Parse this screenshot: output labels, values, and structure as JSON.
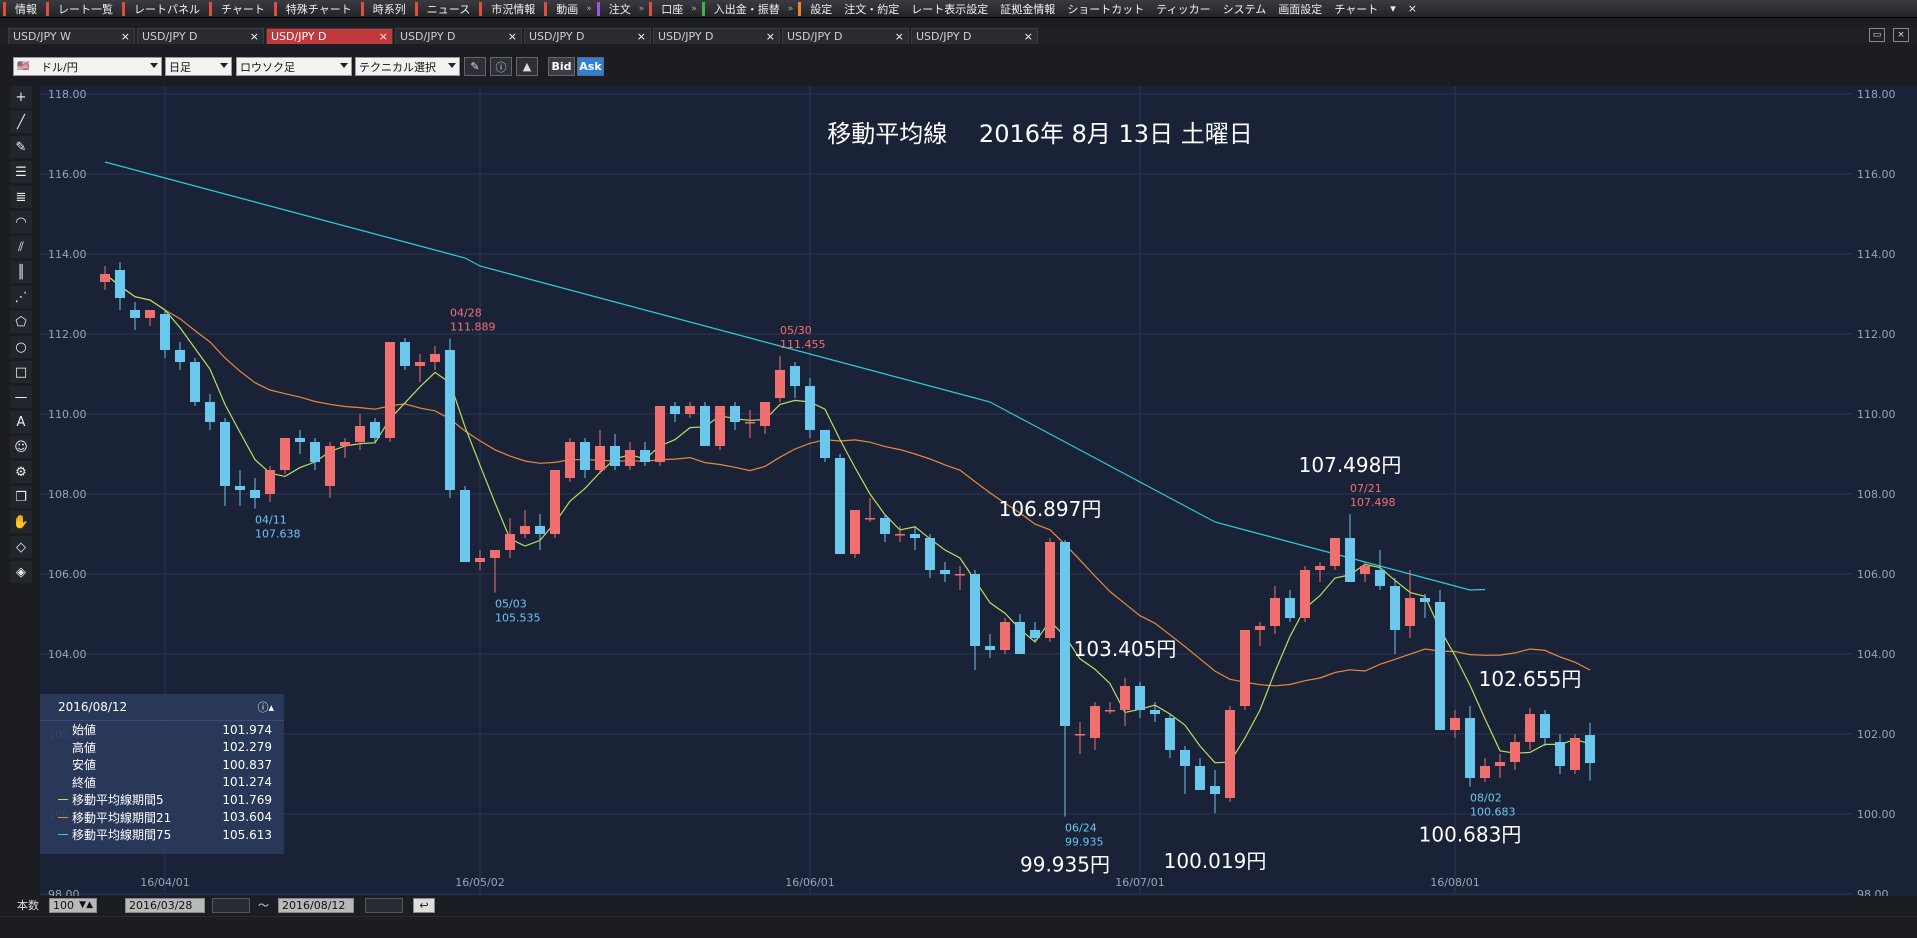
{
  "menu": {
    "items": [
      {
        "label": "情報",
        "color": "#e44c3c"
      },
      {
        "label": "レート一覧",
        "color": "#e44c3c"
      },
      {
        "label": "レートパネル",
        "color": "#e44c3c"
      },
      {
        "label": "チャート",
        "color": "#e44c3c"
      },
      {
        "label": "特殊チャート",
        "color": "#e44c3c"
      },
      {
        "label": "時系列",
        "color": "#e44c3c"
      },
      {
        "label": "ニュース",
        "color": "#e44c3c"
      },
      {
        "label": "市況情報",
        "color": "#e44c3c"
      },
      {
        "label": "動画",
        "color": "#e44c3c"
      },
      {
        "label": "注文",
        "color": "#9b59d6"
      },
      {
        "label": "口座",
        "color": "#e44c3c"
      },
      {
        "label": "入出金・振替",
        "color": "#3cb84a"
      },
      {
        "label": "設定",
        "color": "#e88a2a"
      },
      {
        "label": "注文・約定",
        "color": ""
      },
      {
        "label": "レート表示設定",
        "color": ""
      },
      {
        "label": "証拠金情報",
        "color": ""
      },
      {
        "label": "ショートカット",
        "color": ""
      },
      {
        "label": "ティッカー",
        "color": ""
      },
      {
        "label": "システム",
        "color": ""
      },
      {
        "label": "画面設定",
        "color": ""
      },
      {
        "label": "チャート",
        "color": ""
      }
    ],
    "more": "▾",
    "close": "×"
  },
  "tabs": [
    {
      "label": "USD/JPY W",
      "active": false
    },
    {
      "label": "USD/JPY D",
      "active": false
    },
    {
      "label": "USD/JPY D",
      "active": true
    },
    {
      "label": "USD/JPY D",
      "active": false
    },
    {
      "label": "USD/JPY D",
      "active": false
    },
    {
      "label": "USD/JPY D",
      "active": false
    },
    {
      "label": "USD/JPY D",
      "active": false
    },
    {
      "label": "USD/JPY D",
      "active": false
    }
  ],
  "toolbar": {
    "pair": "ドル/円",
    "period": "日足",
    "chart_type": "ロウソク足",
    "technical": "テクニカル選択",
    "bid": "Bid",
    "ask": "Ask"
  },
  "chart_data": {
    "type": "candlestick",
    "title": "移動平均線　 2016年 8月 13日 土曜日",
    "ylim": [
      98,
      118
    ],
    "y_ticks": [
      "118.00",
      "116.00",
      "114.00",
      "112.00",
      "110.00",
      "108.00",
      "106.00",
      "104.00",
      "102.00",
      "100.00",
      "98.00"
    ],
    "x_ticks": [
      {
        "label": "16/04/01",
        "date": "2016-04-01"
      },
      {
        "label": "16/05/02",
        "date": "2016-05-02"
      },
      {
        "label": "16/06/01",
        "date": "2016-06-01"
      },
      {
        "label": "16/07/01",
        "date": "2016-07-01"
      },
      {
        "label": "16/08/01",
        "date": "2016-08-01"
      }
    ],
    "colors": {
      "up": "#f07070",
      "down": "#6bc7ec",
      "ma5": "#b8e05a",
      "ma21": "#e58a3c",
      "ma75": "#2ec9d6",
      "grid": "#2b3650",
      "background": "#1a2238",
      "label_red": "#f07070",
      "label_blue": "#6bc7ec",
      "text": "#ffffff"
    },
    "candles": [
      {
        "d": "2016-03-28",
        "o": 113.3,
        "h": 113.7,
        "l": 113.1,
        "c": 113.5
      },
      {
        "d": "2016-03-29",
        "o": 113.6,
        "h": 113.8,
        "l": 112.6,
        "c": 112.9
      },
      {
        "d": "2016-03-30",
        "o": 112.6,
        "h": 112.8,
        "l": 112.1,
        "c": 112.4
      },
      {
        "d": "2016-03-31",
        "o": 112.4,
        "h": 112.6,
        "l": 112.2,
        "c": 112.6
      },
      {
        "d": "2016-04-01",
        "o": 112.5,
        "h": 112.6,
        "l": 111.4,
        "c": 111.6
      },
      {
        "d": "2016-04-04",
        "o": 111.6,
        "h": 111.8,
        "l": 111.1,
        "c": 111.3
      },
      {
        "d": "2016-04-05",
        "o": 111.3,
        "h": 111.4,
        "l": 110.2,
        "c": 110.3
      },
      {
        "d": "2016-04-06",
        "o": 110.3,
        "h": 110.5,
        "l": 109.6,
        "c": 109.8
      },
      {
        "d": "2016-04-07",
        "o": 109.8,
        "h": 109.9,
        "l": 107.7,
        "c": 108.2
      },
      {
        "d": "2016-04-08",
        "o": 108.2,
        "h": 108.6,
        "l": 107.7,
        "c": 108.1
      },
      {
        "d": "2016-04-11",
        "o": 108.1,
        "h": 108.4,
        "l": 107.638,
        "c": 107.9
      },
      {
        "d": "2016-04-12",
        "o": 108.0,
        "h": 108.7,
        "l": 107.8,
        "c": 108.6
      },
      {
        "d": "2016-04-13",
        "o": 108.6,
        "h": 109.4,
        "l": 108.5,
        "c": 109.4
      },
      {
        "d": "2016-04-14",
        "o": 109.4,
        "h": 109.6,
        "l": 109.0,
        "c": 109.3
      },
      {
        "d": "2016-04-15",
        "o": 109.3,
        "h": 109.4,
        "l": 108.6,
        "c": 108.8
      },
      {
        "d": "2016-04-18",
        "o": 108.2,
        "h": 109.3,
        "l": 107.9,
        "c": 109.2
      },
      {
        "d": "2016-04-19",
        "o": 109.2,
        "h": 109.4,
        "l": 108.9,
        "c": 109.3
      },
      {
        "d": "2016-04-20",
        "o": 109.3,
        "h": 110.0,
        "l": 109.1,
        "c": 109.7
      },
      {
        "d": "2016-04-21",
        "o": 109.8,
        "h": 109.9,
        "l": 109.3,
        "c": 109.4
      },
      {
        "d": "2016-04-22",
        "o": 109.4,
        "h": 111.8,
        "l": 109.3,
        "c": 111.8
      },
      {
        "d": "2016-04-25",
        "o": 111.8,
        "h": 111.9,
        "l": 111.1,
        "c": 111.2
      },
      {
        "d": "2016-04-26",
        "o": 111.2,
        "h": 111.5,
        "l": 110.8,
        "c": 111.3
      },
      {
        "d": "2016-04-27",
        "o": 111.3,
        "h": 111.7,
        "l": 111.1,
        "c": 111.5
      },
      {
        "d": "2016-04-28",
        "o": 111.6,
        "h": 111.889,
        "l": 107.9,
        "c": 108.1
      },
      {
        "d": "2016-04-29",
        "o": 108.1,
        "h": 108.2,
        "l": 106.3,
        "c": 106.3
      },
      {
        "d": "2016-05-02",
        "o": 106.3,
        "h": 106.6,
        "l": 106.1,
        "c": 106.4
      },
      {
        "d": "2016-05-03",
        "o": 106.4,
        "h": 106.6,
        "l": 105.535,
        "c": 106.6
      },
      {
        "d": "2016-05-04",
        "o": 106.6,
        "h": 107.4,
        "l": 106.4,
        "c": 107.0
      },
      {
        "d": "2016-05-05",
        "o": 107.0,
        "h": 107.6,
        "l": 106.9,
        "c": 107.2
      },
      {
        "d": "2016-05-06",
        "o": 107.2,
        "h": 107.5,
        "l": 106.6,
        "c": 107.0
      },
      {
        "d": "2016-05-09",
        "o": 107.0,
        "h": 108.6,
        "l": 106.9,
        "c": 108.6
      },
      {
        "d": "2016-05-10",
        "o": 108.4,
        "h": 109.4,
        "l": 108.3,
        "c": 109.3
      },
      {
        "d": "2016-05-11",
        "o": 109.3,
        "h": 109.4,
        "l": 108.4,
        "c": 108.6
      },
      {
        "d": "2016-05-12",
        "o": 108.6,
        "h": 109.6,
        "l": 108.5,
        "c": 109.2
      },
      {
        "d": "2016-05-13",
        "o": 109.2,
        "h": 109.5,
        "l": 108.6,
        "c": 108.7
      },
      {
        "d": "2016-05-16",
        "o": 108.7,
        "h": 109.3,
        "l": 108.6,
        "c": 109.1
      },
      {
        "d": "2016-05-17",
        "o": 109.1,
        "h": 109.3,
        "l": 108.7,
        "c": 108.8
      },
      {
        "d": "2016-05-18",
        "o": 108.8,
        "h": 110.2,
        "l": 108.7,
        "c": 110.2
      },
      {
        "d": "2016-05-19",
        "o": 110.2,
        "h": 110.3,
        "l": 109.8,
        "c": 110.0
      },
      {
        "d": "2016-05-20",
        "o": 110.0,
        "h": 110.3,
        "l": 109.9,
        "c": 110.2
      },
      {
        "d": "2016-05-23",
        "o": 110.2,
        "h": 110.3,
        "l": 109.2,
        "c": 109.2
      },
      {
        "d": "2016-05-24",
        "o": 109.2,
        "h": 110.2,
        "l": 109.1,
        "c": 110.2
      },
      {
        "d": "2016-05-25",
        "o": 110.2,
        "h": 110.3,
        "l": 109.6,
        "c": 109.8
      },
      {
        "d": "2016-05-26",
        "o": 109.8,
        "h": 110.1,
        "l": 109.4,
        "c": 109.8
      },
      {
        "d": "2016-05-27",
        "o": 109.7,
        "h": 110.3,
        "l": 109.5,
        "c": 110.3
      },
      {
        "d": "2016-05-30",
        "o": 110.4,
        "h": 111.455,
        "l": 110.3,
        "c": 111.1
      },
      {
        "d": "2016-05-31",
        "o": 111.2,
        "h": 111.3,
        "l": 110.4,
        "c": 110.7
      },
      {
        "d": "2016-06-01",
        "o": 110.7,
        "h": 110.9,
        "l": 109.4,
        "c": 109.6
      },
      {
        "d": "2016-06-02",
        "o": 109.6,
        "h": 109.6,
        "l": 108.8,
        "c": 108.9
      },
      {
        "d": "2016-06-03",
        "o": 108.9,
        "h": 109.0,
        "l": 106.5,
        "c": 106.5
      },
      {
        "d": "2016-06-06",
        "o": 106.5,
        "h": 107.6,
        "l": 106.4,
        "c": 107.6
      },
      {
        "d": "2016-06-07",
        "o": 107.4,
        "h": 107.9,
        "l": 107.3,
        "c": 107.4
      },
      {
        "d": "2016-06-08",
        "o": 107.4,
        "h": 107.5,
        "l": 106.8,
        "c": 107.0
      },
      {
        "d": "2016-06-09",
        "o": 107.0,
        "h": 107.2,
        "l": 106.8,
        "c": 107.0
      },
      {
        "d": "2016-06-10",
        "o": 107.0,
        "h": 107.2,
        "l": 106.6,
        "c": 106.9
      },
      {
        "d": "2016-06-13",
        "o": 106.9,
        "h": 107.0,
        "l": 105.9,
        "c": 106.1
      },
      {
        "d": "2016-06-14",
        "o": 106.1,
        "h": 106.3,
        "l": 105.8,
        "c": 106.0
      },
      {
        "d": "2016-06-15",
        "o": 106.0,
        "h": 106.2,
        "l": 105.6,
        "c": 106.0
      },
      {
        "d": "2016-06-16",
        "o": 106.0,
        "h": 106.1,
        "l": 103.6,
        "c": 104.2
      },
      {
        "d": "2016-06-17",
        "o": 104.2,
        "h": 104.5,
        "l": 103.9,
        "c": 104.1
      },
      {
        "d": "2016-06-20",
        "o": 104.1,
        "h": 104.9,
        "l": 104.0,
        "c": 104.8
      },
      {
        "d": "2016-06-21",
        "o": 104.8,
        "h": 105.0,
        "l": 104.0,
        "c": 104.0
      },
      {
        "d": "2016-06-22",
        "o": 104.6,
        "h": 104.8,
        "l": 104.3,
        "c": 104.4
      },
      {
        "d": "2016-06-23",
        "o": 104.4,
        "h": 106.897,
        "l": 104.3,
        "c": 106.8
      },
      {
        "d": "2016-06-24",
        "o": 106.8,
        "h": 106.85,
        "l": 99.935,
        "c": 102.2
      },
      {
        "d": "2016-06-27",
        "o": 102.0,
        "h": 102.3,
        "l": 101.5,
        "c": 102.0
      },
      {
        "d": "2016-06-28",
        "o": 101.9,
        "h": 102.8,
        "l": 101.6,
        "c": 102.7
      },
      {
        "d": "2016-06-29",
        "o": 102.6,
        "h": 102.8,
        "l": 102.5,
        "c": 102.6
      },
      {
        "d": "2016-06-30",
        "o": 102.6,
        "h": 103.405,
        "l": 102.2,
        "c": 103.2
      },
      {
        "d": "2016-07-01",
        "o": 103.2,
        "h": 103.3,
        "l": 102.4,
        "c": 102.6
      },
      {
        "d": "2016-07-04",
        "o": 102.6,
        "h": 102.8,
        "l": 102.3,
        "c": 102.5
      },
      {
        "d": "2016-07-05",
        "o": 102.4,
        "h": 102.5,
        "l": 101.4,
        "c": 101.6
      },
      {
        "d": "2016-07-06",
        "o": 101.6,
        "h": 101.7,
        "l": 100.5,
        "c": 101.2
      },
      {
        "d": "2016-07-07",
        "o": 101.2,
        "h": 101.4,
        "l": 100.6,
        "c": 100.6
      },
      {
        "d": "2016-07-08",
        "o": 100.7,
        "h": 101.1,
        "l": 100.019,
        "c": 100.5
      },
      {
        "d": "2016-07-11",
        "o": 100.4,
        "h": 102.7,
        "l": 100.3,
        "c": 102.6
      },
      {
        "d": "2016-07-12",
        "o": 102.7,
        "h": 104.6,
        "l": 102.6,
        "c": 104.6
      },
      {
        "d": "2016-07-13",
        "o": 104.6,
        "h": 104.8,
        "l": 104.2,
        "c": 104.7
      },
      {
        "d": "2016-07-14",
        "o": 104.7,
        "h": 105.7,
        "l": 104.5,
        "c": 105.4
      },
      {
        "d": "2016-07-15",
        "o": 105.4,
        "h": 105.6,
        "l": 104.8,
        "c": 104.9
      },
      {
        "d": "2016-07-18",
        "o": 104.9,
        "h": 106.2,
        "l": 104.8,
        "c": 106.1
      },
      {
        "d": "2016-07-19",
        "o": 106.1,
        "h": 106.3,
        "l": 105.8,
        "c": 106.2
      },
      {
        "d": "2016-07-20",
        "o": 106.2,
        "h": 106.9,
        "l": 106.1,
        "c": 106.9
      },
      {
        "d": "2016-07-21",
        "o": 106.9,
        "h": 107.498,
        "l": 105.8,
        "c": 105.8
      },
      {
        "d": "2016-07-22",
        "o": 106.0,
        "h": 106.3,
        "l": 105.8,
        "c": 106.2
      },
      {
        "d": "2016-07-25",
        "o": 106.1,
        "h": 106.6,
        "l": 105.6,
        "c": 105.7
      },
      {
        "d": "2016-07-26",
        "o": 105.7,
        "h": 105.9,
        "l": 104.0,
        "c": 104.6
      },
      {
        "d": "2016-07-27",
        "o": 104.7,
        "h": 106.1,
        "l": 104.4,
        "c": 105.4
      },
      {
        "d": "2016-07-28",
        "o": 105.4,
        "h": 105.5,
        "l": 104.9,
        "c": 105.3
      },
      {
        "d": "2016-07-29",
        "o": 105.3,
        "h": 105.6,
        "l": 102.1,
        "c": 102.1
      },
      {
        "d": "2016-08-01",
        "o": 102.1,
        "h": 102.6,
        "l": 101.9,
        "c": 102.4
      },
      {
        "d": "2016-08-02",
        "o": 102.4,
        "h": 102.7,
        "l": 100.683,
        "c": 100.9
      },
      {
        "d": "2016-08-03",
        "o": 100.9,
        "h": 101.4,
        "l": 100.8,
        "c": 101.2
      },
      {
        "d": "2016-08-04",
        "o": 101.2,
        "h": 101.5,
        "l": 100.9,
        "c": 101.3
      },
      {
        "d": "2016-08-05",
        "o": 101.3,
        "h": 102.0,
        "l": 101.1,
        "c": 101.8
      },
      {
        "d": "2016-08-08",
        "o": 101.8,
        "h": 102.655,
        "l": 101.6,
        "c": 102.5
      },
      {
        "d": "2016-08-09",
        "o": 102.5,
        "h": 102.6,
        "l": 101.7,
        "c": 101.9
      },
      {
        "d": "2016-08-10",
        "o": 101.8,
        "h": 102.0,
        "l": 101.0,
        "c": 101.2
      },
      {
        "d": "2016-08-11",
        "o": 101.1,
        "h": 102.0,
        "l": 101.0,
        "c": 101.9
      },
      {
        "d": "2016-08-12",
        "o": 101.974,
        "h": 102.279,
        "l": 100.837,
        "c": 101.274
      }
    ],
    "ma75": [
      116.3,
      116.2,
      116.1,
      116.0,
      115.9,
      115.8,
      115.7,
      115.6,
      115.5,
      115.4,
      115.3,
      115.2,
      115.1,
      115.0,
      114.9,
      114.8,
      114.7,
      114.6,
      114.5,
      114.4,
      114.3,
      114.2,
      114.1,
      114.0,
      113.9,
      113.7,
      113.6,
      113.5,
      113.4,
      113.3,
      113.2,
      113.1,
      113.0,
      112.9,
      112.8,
      112.7,
      112.6,
      112.5,
      112.4,
      112.3,
      112.2,
      112.1,
      112.0,
      111.9,
      111.8,
      111.7,
      111.6,
      111.5,
      111.4,
      111.3,
      111.2,
      111.1,
      111.0,
      110.9,
      110.8,
      110.7,
      110.6,
      110.5,
      110.4,
      110.3,
      110.1,
      109.9,
      109.7,
      109.5,
      109.3,
      109.1,
      108.9,
      108.7,
      108.5,
      108.3,
      108.1,
      107.9,
      107.7,
      107.5,
      107.3,
      107.2,
      107.1,
      107.0,
      106.9,
      106.8,
      106.7,
      106.6,
      106.5,
      106.4,
      106.3,
      106.2,
      106.1,
      106.0,
      105.9,
      105.8,
      105.7,
      105.6,
      105.613
    ]
  },
  "annotations": [
    {
      "date": "04/28",
      "value": "111.889",
      "color": "red",
      "near": "2016-04-28",
      "pos": "above"
    },
    {
      "date": "05/30",
      "value": "111.455",
      "color": "red",
      "near": "2016-05-30",
      "pos": "above"
    },
    {
      "date": "04/11",
      "value": "107.638",
      "color": "blue",
      "near": "2016-04-11",
      "pos": "below"
    },
    {
      "date": "05/03",
      "value": "105.535",
      "color": "blue",
      "near": "2016-05-03",
      "pos": "below"
    },
    {
      "date": "06/24",
      "value": "99.935",
      "color": "blue",
      "near": "2016-06-24",
      "pos": "below"
    },
    {
      "date": "07/21",
      "value": "107.498",
      "color": "red",
      "near": "2016-07-21",
      "pos": "above"
    },
    {
      "date": "08/02",
      "value": "100.683",
      "color": "blue",
      "near": "2016-08-02",
      "pos": "below"
    }
  ],
  "big_labels": [
    {
      "text": "106.897円",
      "near": "2016-06-23",
      "value": 106.897,
      "pos": "above"
    },
    {
      "text": "103.405円",
      "near": "2016-06-30",
      "value": 103.405,
      "pos": "above"
    },
    {
      "text": "107.498円",
      "near": "2016-07-21",
      "value": 107.498,
      "pos": "above2"
    },
    {
      "text": "102.655円",
      "near": "2016-08-08",
      "value": 102.655,
      "pos": "above"
    },
    {
      "text": "99.935円",
      "near": "2016-06-24",
      "value": 99.935,
      "pos": "below"
    },
    {
      "text": "100.019円",
      "near": "2016-07-08",
      "value": 100.019,
      "pos": "below"
    },
    {
      "text": "100.683円",
      "near": "2016-08-02",
      "value": 100.683,
      "pos": "below"
    }
  ],
  "infobox": {
    "date": "2016/08/12",
    "rows": [
      {
        "label": "始値",
        "value": "101.974",
        "color": ""
      },
      {
        "label": "高値",
        "value": "102.279",
        "color": ""
      },
      {
        "label": "安値",
        "value": "100.837",
        "color": ""
      },
      {
        "label": "終値",
        "value": "101.274",
        "color": ""
      },
      {
        "label": "移動平均線期間5",
        "value": "101.769",
        "color": "#b8e05a"
      },
      {
        "label": "移動平均線期間21",
        "value": "103.604",
        "color": "#e58a3c"
      },
      {
        "label": "移動平均線期間75",
        "value": "105.613",
        "color": "#2ec9d6"
      }
    ]
  },
  "bottom": {
    "count_label": "本数",
    "count_value": "100",
    "from": "2016/03/28",
    "tilde": "～",
    "to": "2016/08/12"
  }
}
